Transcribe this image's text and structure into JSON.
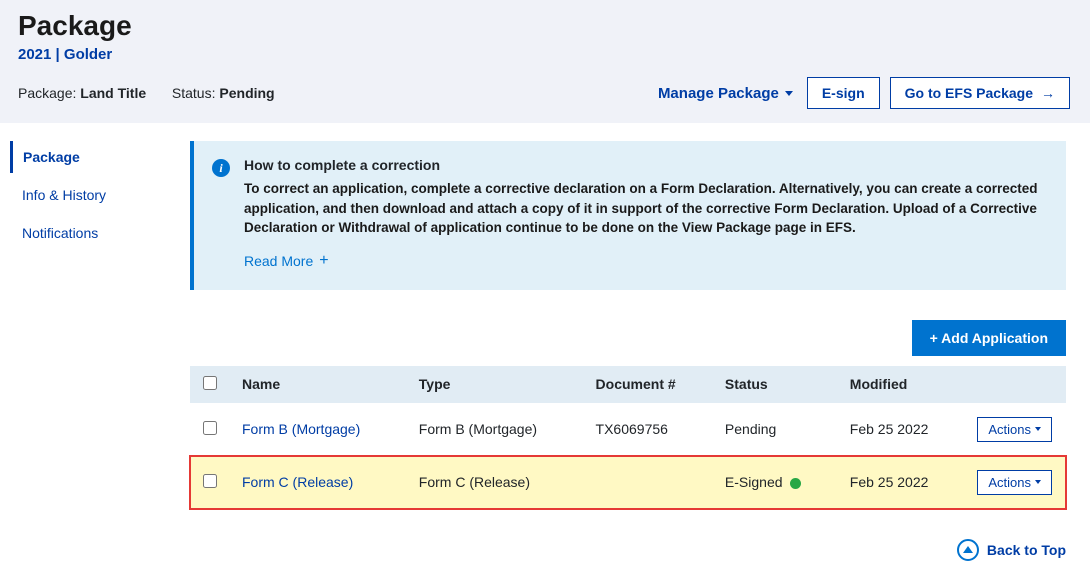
{
  "header": {
    "title": "Package",
    "subtitle": "2021 | Golder",
    "package_label": "Package:",
    "package_value": "Land Title",
    "status_label": "Status:",
    "status_value": "Pending",
    "manage_label": "Manage Package",
    "esign_label": "E-sign",
    "efs_label": "Go to EFS Package"
  },
  "sidebar": {
    "items": [
      {
        "label": "Package",
        "active": true
      },
      {
        "label": "Info & History",
        "active": false
      },
      {
        "label": "Notifications",
        "active": false
      }
    ]
  },
  "infobox": {
    "title": "How to complete a correction",
    "body": "To correct an application, complete a corrective declaration on a Form Declaration. Alternatively, you can create a corrected application, and then download and attach a copy of it in support of the corrective Form Declaration. Upload of a Corrective Declaration or Withdrawal of application continue to be done on the View Package page in EFS.",
    "read_more": "Read More"
  },
  "table": {
    "add_button": "+ Add Application",
    "headers": {
      "name": "Name",
      "type": "Type",
      "doc": "Document #",
      "status": "Status",
      "modified": "Modified"
    },
    "action_label": "Actions",
    "rows": [
      {
        "name": "Form B (Mortgage)",
        "type": "Form B (Mortgage)",
        "doc": "TX6069756",
        "status": "Pending",
        "status_dot": false,
        "modified": "Feb 25 2022",
        "highlight": false
      },
      {
        "name": "Form C (Release)",
        "type": "Form C (Release)",
        "doc": "",
        "status": "E-Signed",
        "status_dot": true,
        "modified": "Feb 25 2022",
        "highlight": true
      }
    ]
  },
  "footer": {
    "back_to_top": "Back to Top"
  }
}
